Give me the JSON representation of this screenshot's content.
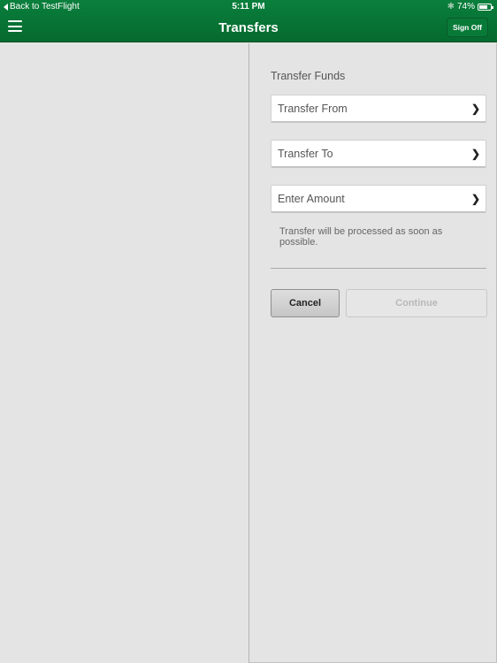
{
  "status_bar": {
    "back_label": "Back to TestFlight",
    "time": "5:11 PM",
    "battery_percent": "74%",
    "battery_level": 0.74
  },
  "nav": {
    "title": "Transfers",
    "sign_off_label": "Sign Off"
  },
  "form": {
    "section_title": "Transfer Funds",
    "fields": [
      {
        "label": "Transfer From"
      },
      {
        "label": "Transfer To"
      },
      {
        "label": "Enter Amount"
      }
    ],
    "note": "Transfer will be processed as soon as possible.",
    "cancel_label": "Cancel",
    "continue_label": "Continue"
  },
  "icons": {
    "menu": "hamburger-icon",
    "chevron": "chevron-right-icon",
    "back": "back-triangle-icon",
    "bluetooth": "bluetooth-icon",
    "battery": "battery-icon"
  }
}
